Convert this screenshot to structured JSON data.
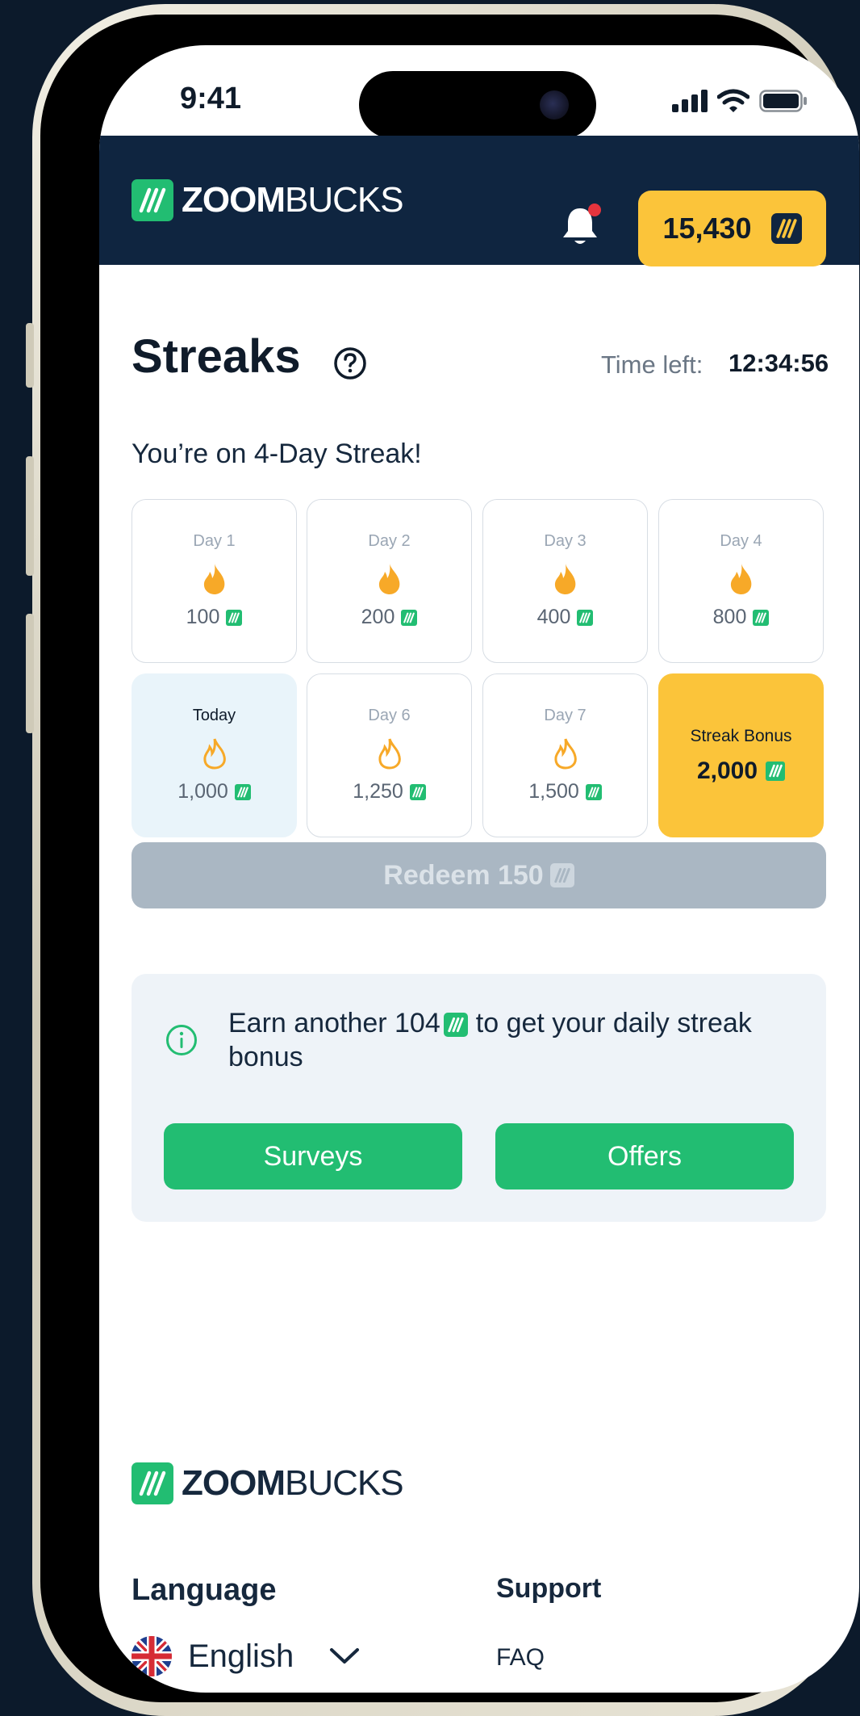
{
  "status_bar": {
    "time": "9:41"
  },
  "brand": {
    "name_bold": "ZOOM",
    "name_regular": "BUCKS"
  },
  "header": {
    "balance": "15,430",
    "has_notification": true
  },
  "streaks": {
    "title": "Streaks",
    "time_left_label": "Time left:",
    "time_left_value": "12:34:56",
    "subtitle": "You’re on 4-Day Streak!",
    "days": [
      {
        "label": "Day 1",
        "reward": "100",
        "completed": true
      },
      {
        "label": "Day 2",
        "reward": "200",
        "completed": true
      },
      {
        "label": "Day 3",
        "reward": "400",
        "completed": true
      },
      {
        "label": "Day 4",
        "reward": "800",
        "completed": true
      },
      {
        "label": "Today",
        "reward": "1,000",
        "completed": false
      },
      {
        "label": "Day 6",
        "reward": "1,250",
        "completed": false
      },
      {
        "label": "Day 7",
        "reward": "1,500",
        "completed": false
      }
    ],
    "bonus": {
      "label": "Streak Bonus",
      "value": "2,000"
    },
    "redeem_label": "Redeem 150"
  },
  "info": {
    "text_before": "Earn another 104",
    "text_after": "to get your daily streak bonus",
    "surveys_label": "Surveys",
    "offers_label": "Offers"
  },
  "footer": {
    "language_title": "Language",
    "language_value": "English",
    "support_title": "Support",
    "faq_label": "FAQ"
  },
  "colors": {
    "brand_green": "#22bd72",
    "header_navy": "#0f2540",
    "accent_yellow": "#fbc43a",
    "flame_orange": "#f7a928"
  }
}
